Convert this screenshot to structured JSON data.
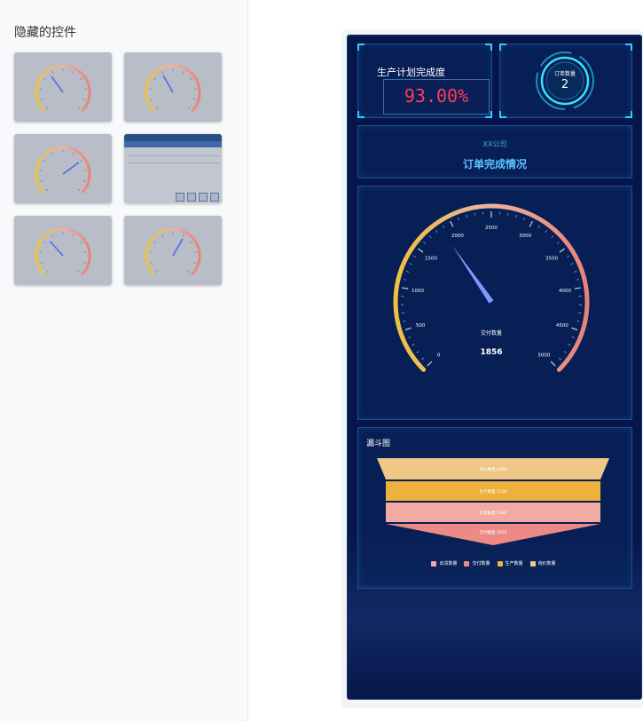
{
  "sidebar": {
    "title": "隐藏的控件",
    "thumbnails": [
      "gauge",
      "gauge",
      "gauge",
      "table",
      "gauge",
      "gauge"
    ]
  },
  "dashboard": {
    "progress": {
      "label": "生产计划完成度",
      "value": "93.00%"
    },
    "orders": {
      "label": "订单数量",
      "value": "2"
    },
    "header": {
      "company": "XX公司",
      "title": "订单完成情况"
    },
    "gauge": {
      "min": 0,
      "max": 5000,
      "value": 1856,
      "label": "交付数量",
      "value_text": "1856",
      "ticks": [
        "0",
        "500",
        "1000",
        "1500",
        "2000",
        "2500",
        "3000",
        "3500",
        "4000",
        "4500",
        "5000"
      ]
    },
    "funnel": {
      "title": "漏斗图",
      "stages": [
        {
          "label": "询价数量",
          "value": 2000,
          "text": "询价数量 2000",
          "color": "#efc888"
        },
        {
          "label": "生产数量",
          "value": 1500,
          "text": "生产数量 1500",
          "color": "#eeb23c"
        },
        {
          "label": "出货数量",
          "value": 1000,
          "text": "出货数量 1000",
          "color": "#f1aaa4"
        },
        {
          "label": "交付数量",
          "value": 1856,
          "text": "交付数量 1856",
          "color": "#ee8a86"
        }
      ],
      "legend": [
        {
          "label": "出货数量",
          "color": "#f1aaa4"
        },
        {
          "label": "交付数量",
          "color": "#ee8a86"
        },
        {
          "label": "生产数量",
          "color": "#eeb23c"
        },
        {
          "label": "询价数量",
          "color": "#efc888"
        }
      ]
    }
  }
}
